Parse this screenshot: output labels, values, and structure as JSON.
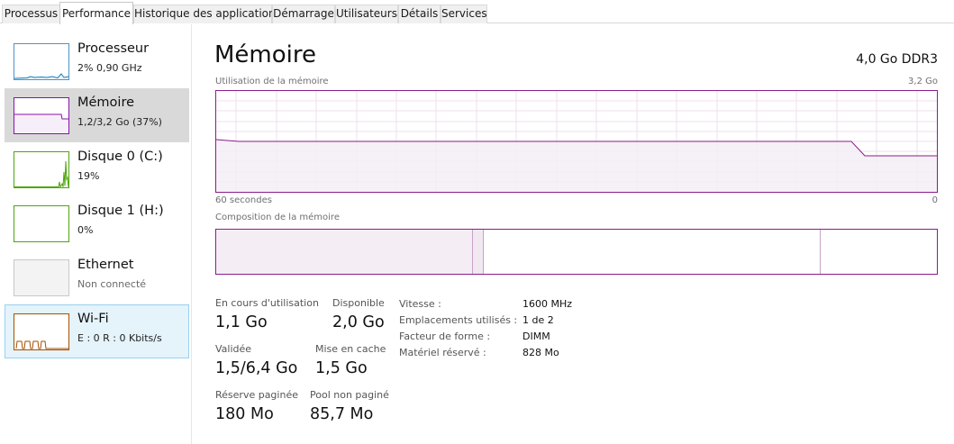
{
  "tabs": [
    {
      "label": "Processus",
      "active": false
    },
    {
      "label": "Performance",
      "active": true
    },
    {
      "label": "Historique des applications",
      "active": false
    },
    {
      "label": "Démarrage",
      "active": false
    },
    {
      "label": "Utilisateurs",
      "active": false
    },
    {
      "label": "Détails",
      "active": false
    },
    {
      "label": "Services",
      "active": false
    }
  ],
  "sidebar": {
    "items": [
      {
        "title": "Processeur",
        "subtitle": "2% 0,90 GHz",
        "state": "normal",
        "thumb_color": "#117dbb"
      },
      {
        "title": "Mémoire",
        "subtitle": "1,2/3,2 Go (37%)",
        "state": "selected",
        "thumb_color": "#8b12ae"
      },
      {
        "title": "Disque 0 (C:)",
        "subtitle": "19%",
        "state": "normal",
        "thumb_color": "#4da60c"
      },
      {
        "title": "Disque 1 (H:)",
        "subtitle": "0%",
        "state": "normal",
        "thumb_color": "#4da60c"
      },
      {
        "title": "Ethernet",
        "subtitle": "Non connecté",
        "state": "disabled",
        "thumb_color": "#c0c0c0"
      },
      {
        "title": "Wi-Fi",
        "subtitle": "E : 0 R : 0 Kbits/s",
        "state": "hover",
        "thumb_color": "#a74f01"
      }
    ]
  },
  "main": {
    "title": "Mémoire",
    "spec": "4,0 Go DDR3",
    "usage_graph": {
      "label": "Utilisation de la mémoire",
      "max_label": "3,2 Go",
      "time_label": "60 secondes",
      "zero_label": "0",
      "color": "#8b1c8b"
    },
    "composition": {
      "label": "Composition de la mémoire"
    },
    "stats": {
      "in_use": {
        "label": "En cours d'utilisation",
        "value": "1,1 Go"
      },
      "available": {
        "label": "Disponible",
        "value": "2,0 Go"
      },
      "committed": {
        "label": "Validée",
        "value": "1,5/6,4 Go"
      },
      "cached": {
        "label": "Mise en cache",
        "value": "1,5 Go"
      },
      "paged_pool": {
        "label": "Réserve paginée",
        "value": "180 Mo"
      },
      "nonpaged_pool": {
        "label": "Pool non paginé",
        "value": "85,7 Mo"
      }
    },
    "specs": [
      {
        "label": "Vitesse :",
        "value": "1600 MHz"
      },
      {
        "label": "Emplacements utilisés :",
        "value": "1 de 2"
      },
      {
        "label": "Facteur de forme :",
        "value": "DIMM"
      },
      {
        "label": "Matériel réservé :",
        "value": "828 Mo"
      }
    ]
  }
}
